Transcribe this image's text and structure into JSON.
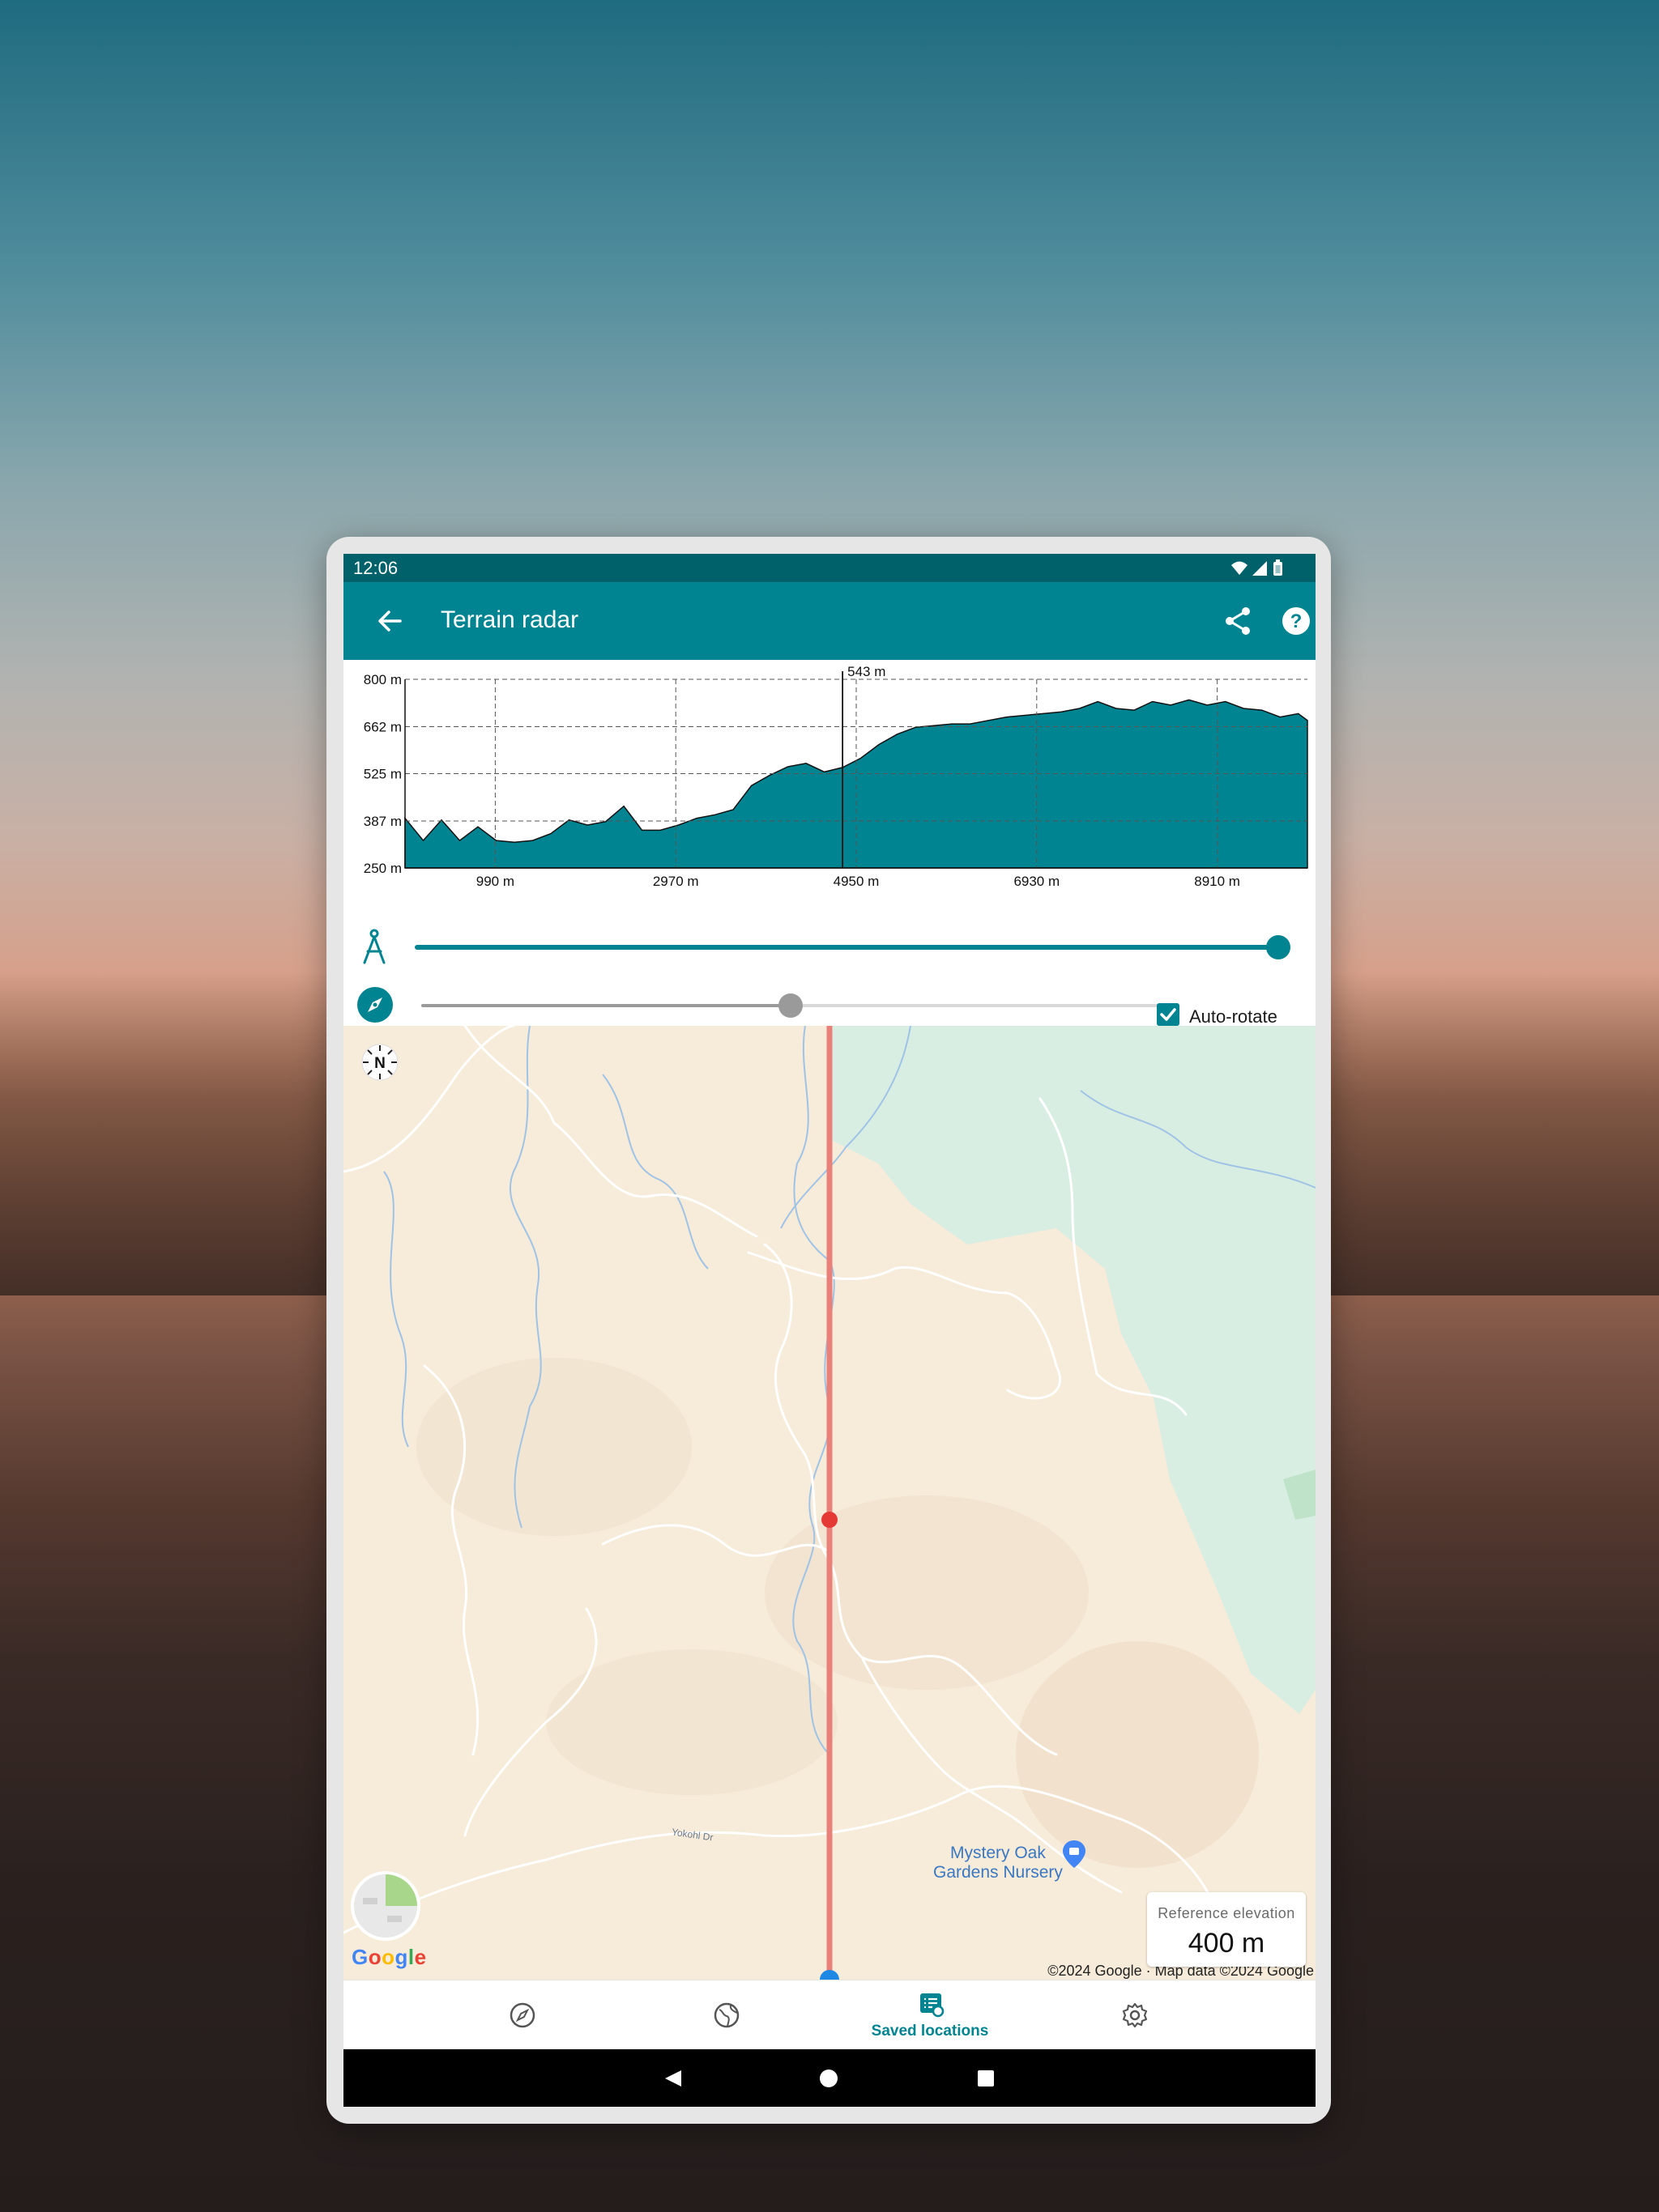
{
  "status_bar": {
    "time": "12:06"
  },
  "app_bar": {
    "title": "Terrain radar",
    "back_icon": "arrow-back-icon",
    "share_icon": "share-icon",
    "help_icon": "help-icon"
  },
  "chart_data": {
    "type": "area",
    "title": "",
    "xlabel": "",
    "ylabel": "",
    "y_ticks": [
      "800 m",
      "662 m",
      "525 m",
      "387 m",
      "250 m"
    ],
    "y_tick_values": [
      800,
      662,
      525,
      387,
      250
    ],
    "x_ticks": [
      "990 m",
      "2970 m",
      "4950 m",
      "6930 m",
      "8910 m"
    ],
    "x_tick_values": [
      990,
      2970,
      4950,
      6930,
      8910
    ],
    "xlim": [
      0,
      9900
    ],
    "ylim": [
      250,
      800
    ],
    "grid": true,
    "cursor": {
      "x": 4800,
      "label": "543 m"
    },
    "color": "#018491",
    "x": [
      0,
      200,
      400,
      600,
      800,
      1000,
      1200,
      1400,
      1600,
      1800,
      2000,
      2200,
      2400,
      2600,
      2800,
      3000,
      3200,
      3400,
      3600,
      3800,
      4000,
      4200,
      4400,
      4600,
      4800,
      5000,
      5200,
      5400,
      5600,
      5800,
      6000,
      6200,
      6400,
      6600,
      6800,
      7000,
      7200,
      7400,
      7600,
      7800,
      8000,
      8200,
      8400,
      8600,
      8800,
      9000,
      9200,
      9400,
      9600,
      9800,
      9900
    ],
    "y": [
      395,
      330,
      390,
      330,
      370,
      330,
      325,
      330,
      350,
      390,
      375,
      385,
      430,
      360,
      360,
      375,
      395,
      405,
      420,
      490,
      520,
      545,
      555,
      530,
      543,
      570,
      610,
      640,
      660,
      665,
      670,
      670,
      680,
      690,
      695,
      700,
      705,
      715,
      735,
      715,
      710,
      735,
      725,
      740,
      725,
      735,
      715,
      710,
      690,
      700,
      680
    ]
  },
  "sliders": {
    "distance_level": 1.0,
    "rotation_level": 0.5,
    "auto_rotate_label": "Auto-rotate",
    "auto_rotate_checked": true
  },
  "map": {
    "poi_name_line1": "Mystery Oak",
    "poi_name_line2": "Gardens Nursery",
    "road_label": "Yokohl Dr",
    "attribution": "©2024 Google · Map data ©2024 Google",
    "google_logo": "Google",
    "compass_label": "N",
    "reference_label": "Reference elevation",
    "reference_value": "400 m"
  },
  "bottom_nav": {
    "items": [
      {
        "icon": "compass-nav-icon",
        "label": ""
      },
      {
        "icon": "globe-icon",
        "label": ""
      },
      {
        "icon": "saved-locations-icon",
        "label": "Saved locations"
      },
      {
        "icon": "settings-gear-icon",
        "label": ""
      }
    ]
  },
  "system_nav": {
    "back_icon": "back-triangle-icon",
    "home_icon": "home-circle-icon",
    "recents_icon": "recents-square-icon"
  }
}
